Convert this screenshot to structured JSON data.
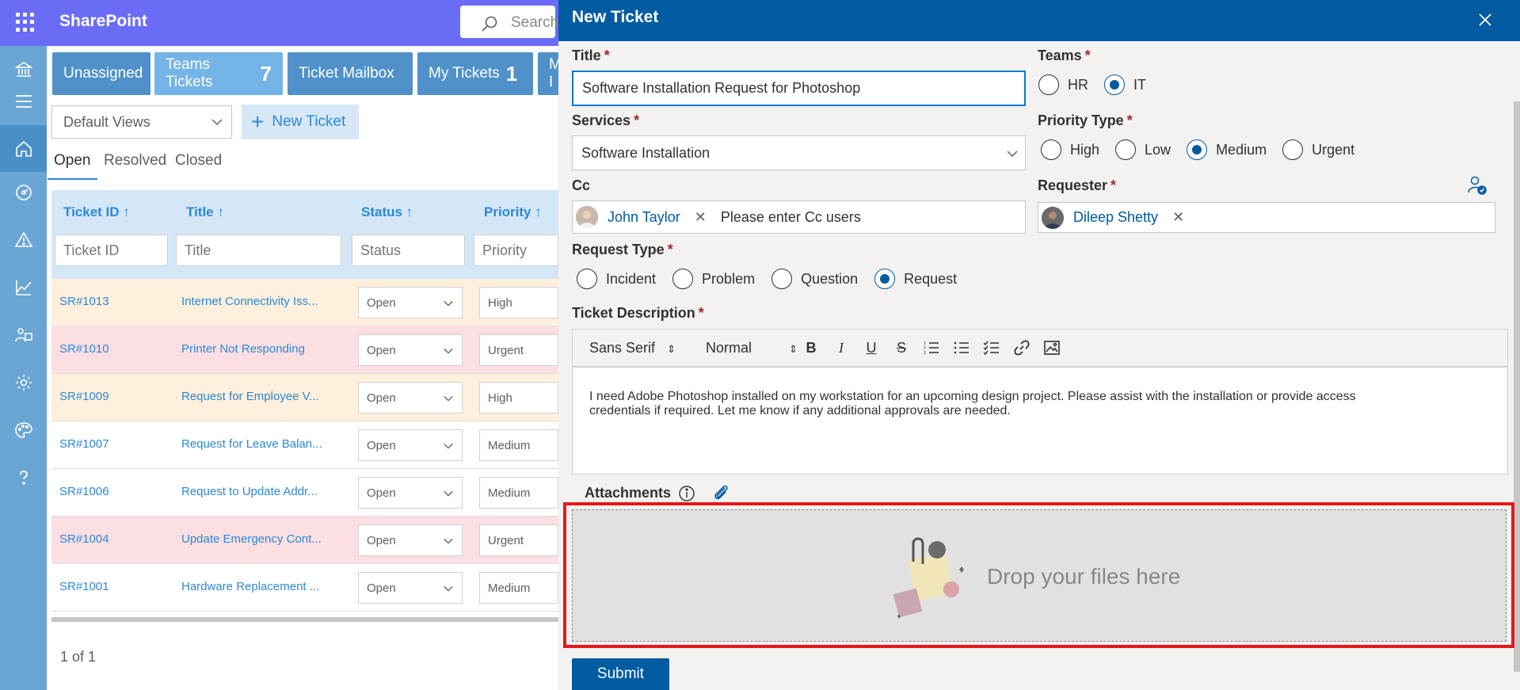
{
  "app": {
    "name": "SharePoint",
    "search_placeholder": "Search"
  },
  "team_tabs": [
    {
      "label": "Unassigned",
      "count": ""
    },
    {
      "label": "Teams Tickets",
      "count": "7"
    },
    {
      "label": "Ticket Mailbox",
      "count": ""
    },
    {
      "label": "My Tickets",
      "count": "1"
    },
    {
      "label": "My I",
      "count": ""
    }
  ],
  "views_dropdown": "Default Views",
  "new_ticket_button": "New Ticket",
  "status_tabs": [
    "Open",
    "Resolved",
    "Closed"
  ],
  "grid": {
    "headers": [
      "Ticket ID ↑",
      "Title ↑",
      "Status ↑",
      "Priority ↑"
    ],
    "filters": [
      "Ticket ID",
      "Title",
      "Status",
      "Priority"
    ],
    "rows": [
      {
        "id": "SR#1013",
        "title": "Internet Connectivity Iss...",
        "status": "Open",
        "priority": "High",
        "level": "high"
      },
      {
        "id": "SR#1010",
        "title": "Printer Not Responding",
        "status": "Open",
        "priority": "Urgent",
        "level": "urgent"
      },
      {
        "id": "SR#1009",
        "title": "Request for Employee V...",
        "status": "Open",
        "priority": "High",
        "level": "high"
      },
      {
        "id": "SR#1007",
        "title": "Request for Leave Balan...",
        "status": "Open",
        "priority": "Medium",
        "level": "medium"
      },
      {
        "id": "SR#1006",
        "title": "Request to Update Addr...",
        "status": "Open",
        "priority": "Medium",
        "level": "medium"
      },
      {
        "id": "SR#1004",
        "title": "Update Emergency Cont...",
        "status": "Open",
        "priority": "Urgent",
        "level": "urgent"
      },
      {
        "id": "SR#1001",
        "title": "Hardware Replacement ...",
        "status": "Open",
        "priority": "Medium",
        "level": "medium"
      }
    ],
    "pager": "1 of 1"
  },
  "panel": {
    "title": "New Ticket",
    "title_label": "Title",
    "title_value": "Software Installation Request for Photoshop",
    "teams_label": "Teams",
    "teams_options": [
      "HR",
      "IT"
    ],
    "teams_selected": "IT",
    "services_label": "Services",
    "services_value": "Software Installation",
    "priority_label": "Priority Type",
    "priority_options": [
      "High",
      "Low",
      "Medium",
      "Urgent"
    ],
    "priority_selected": "Medium",
    "cc_label": "Cc",
    "cc_user": "John Taylor",
    "cc_placeholder": "Please enter Cc users",
    "requester_label": "Requester",
    "requester_user": "Dileep Shetty",
    "request_type_label": "Request Type",
    "request_type_options": [
      "Incident",
      "Problem",
      "Question",
      "Request"
    ],
    "request_type_selected": "Request",
    "description_label": "Ticket Description",
    "toolbar_font": "Sans Serif",
    "toolbar_size": "Normal",
    "description_line1": "I need Adobe Photoshop installed on my workstation for an upcoming design project. Please assist with the installation or provide access",
    "description_line2": "credentials if required. Let me know if any additional approvals are needed.",
    "attachments_label": "Attachments",
    "drop_text": "Drop your files here",
    "submit_label": "Submit",
    "required_mark": "*"
  },
  "colors": {
    "topbar": "#6b6cf6",
    "rail": "#6aa6d3",
    "panel_header": "#005ba1",
    "accent": "#2b88d8",
    "high_row": "#fef0dc",
    "urgent_row": "#fcdfe2",
    "highlight": "#e8161b"
  },
  "icons": [
    "waffle-icon",
    "search-icon",
    "bank-icon",
    "hamburger-icon",
    "home-icon",
    "dashboard-icon",
    "warning-icon",
    "chart-icon",
    "people-icon",
    "gear-icon",
    "palette-icon",
    "help-icon",
    "close-icon",
    "info-icon",
    "paperclip-icon",
    "person-check-icon"
  ]
}
